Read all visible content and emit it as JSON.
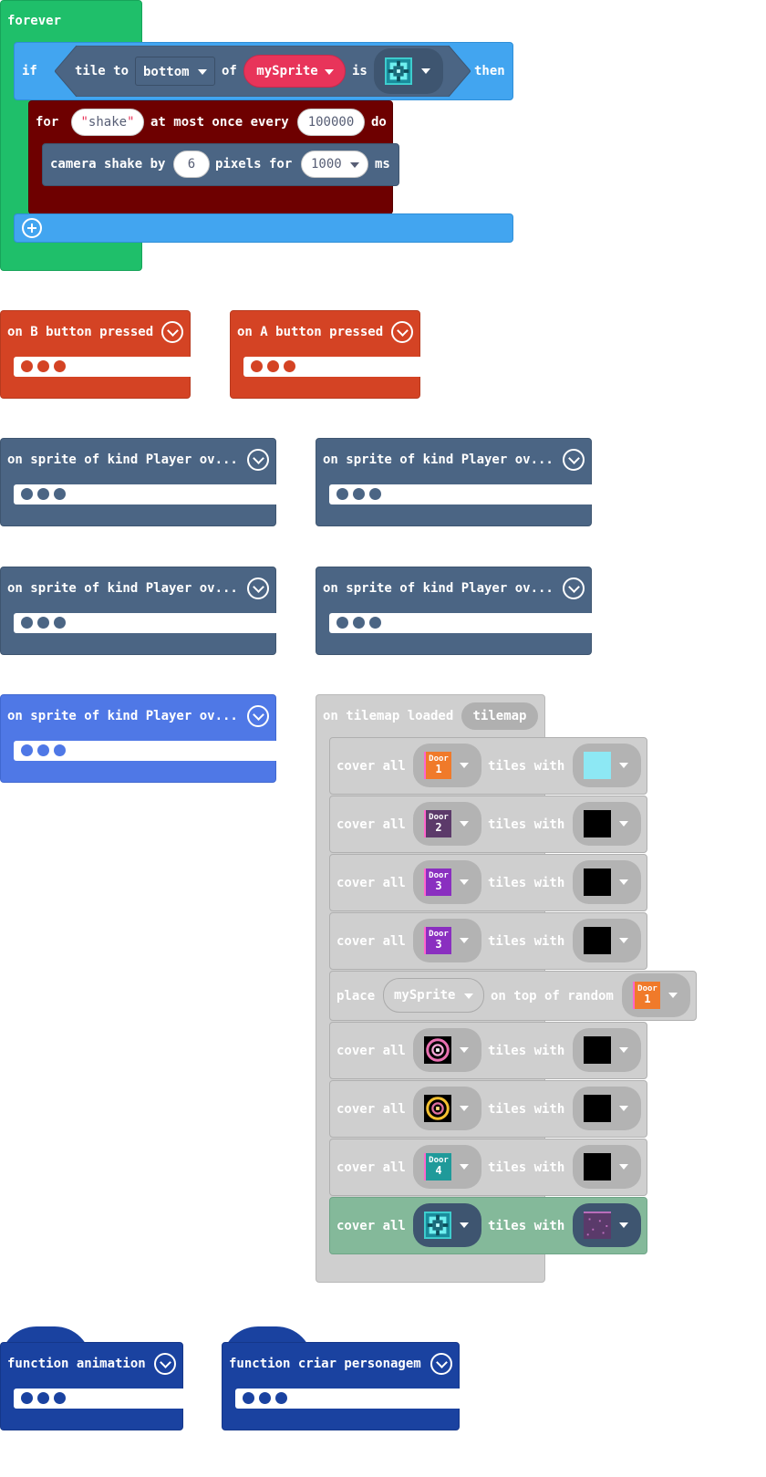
{
  "forever": {
    "label": "forever",
    "if_label": "if",
    "then_label": "then",
    "tile_to": "tile to",
    "direction": "bottom",
    "of_label": "of",
    "sprite": "mySprite",
    "is_label": "is",
    "for_label": "for",
    "shake_text": "shake",
    "at_most": "at most once every",
    "interval": "100000",
    "do_label": "do",
    "camera_shake": "camera shake by",
    "shake_amount": "6",
    "pixels_for": "pixels for",
    "duration": "1000",
    "ms_label": "ms"
  },
  "button_events": [
    {
      "label": "on B button pressed"
    },
    {
      "label": "on A button pressed"
    }
  ],
  "overlap_events": [
    {
      "label": "on sprite of kind Player ov..."
    },
    {
      "label": "on sprite of kind Player ov..."
    },
    {
      "label": "on sprite of kind Player ov..."
    },
    {
      "label": "on sprite of kind Player ov..."
    },
    {
      "label": "on sprite of kind Player ov..."
    }
  ],
  "tilemap": {
    "label": "on tilemap loaded",
    "param": "tilemap",
    "cover_all": "cover all",
    "tiles_with": "tiles with",
    "place_label": "place",
    "place_sprite": "mySprite",
    "on_top_of_random": "on top of random",
    "door_word": "Door",
    "door_numbers": [
      "1",
      "2",
      "3",
      "3",
      "1",
      "4"
    ]
  },
  "functions": [
    {
      "label": "function animation"
    },
    {
      "label": "function criar personagem"
    }
  ],
  "colors": {
    "forever": "#1fbf6a",
    "logic": "#42a5f0",
    "compare": "#4b6584",
    "loop_throttle": "#6e0000",
    "camera": "#4b6584",
    "controller": "#d44324",
    "sprites": "#4b6584",
    "sprites_highlight": "#4f78e6",
    "tilemap_disabled": "#cfcfcf",
    "tilemap_active": "#84b99a",
    "functions": "#1a42a0",
    "sprite_pill": "#e8345a"
  }
}
